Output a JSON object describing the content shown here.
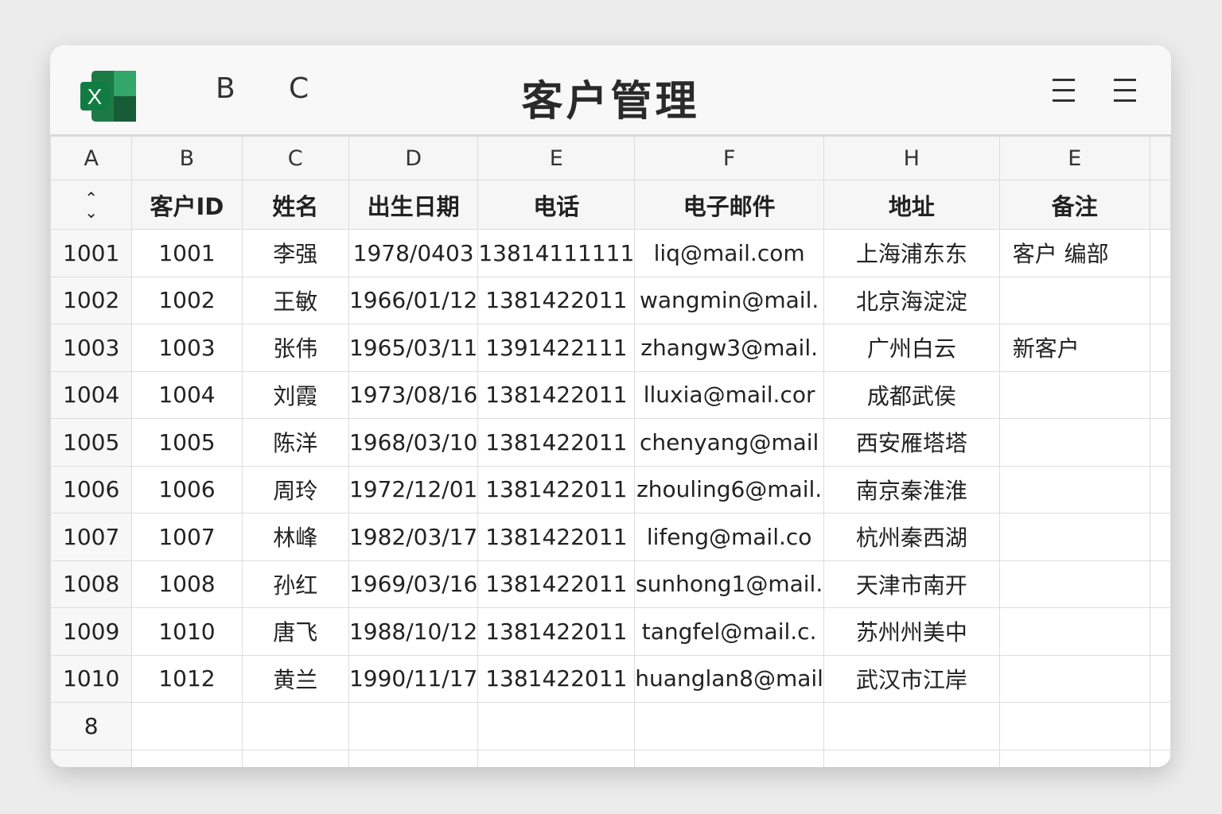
{
  "app": {
    "icon": "excel-icon",
    "icon_letter": "X",
    "tab_b": "B",
    "tab_c": "C",
    "title": "客户管理",
    "menu_icon_1": "menu-icon",
    "menu_icon_2": "menu-icon"
  },
  "column_letters": [
    "A",
    "B",
    "C",
    "D",
    "E",
    "F",
    "H",
    "E"
  ],
  "headers": [
    "客户ID",
    "姓名",
    "出生日期",
    "电话",
    "电子邮件",
    "地址",
    "备注"
  ],
  "sort_icon": "sort-icon",
  "rows": [
    {
      "row": "1001",
      "id": "1001",
      "name": "李强",
      "dob": "1978/0403",
      "phone": "13814111111",
      "email": "liq@mail.com",
      "addr": "上海浦东东",
      "note": "客户   编部"
    },
    {
      "row": "1002",
      "id": "1002",
      "name": "王敏",
      "dob": "1966/01/12",
      "phone": "1381422011",
      "email": "wangmin@mail.",
      "addr": "北京海淀淀",
      "note": ""
    },
    {
      "row": "1003",
      "id": "1003",
      "name": "张伟",
      "dob": "1965/03/11",
      "phone": "1391422111",
      "email": "zhangw3@mail.",
      "addr": "广州白云",
      "note": "新客户"
    },
    {
      "row": "1004",
      "id": "1004",
      "name": "刘霞",
      "dob": "1973/08/16",
      "phone": "1381422011",
      "email": "lluxia@mail.cor",
      "addr": "成都武侯",
      "note": ""
    },
    {
      "row": "1005",
      "id": "1005",
      "name": "陈洋",
      "dob": "1968/03/10",
      "phone": "1381422011",
      "email": "chenyang@mail",
      "addr": "西安雁塔塔",
      "note": ""
    },
    {
      "row": "1006",
      "id": "1006",
      "name": "周玲",
      "dob": "1972/12/01",
      "phone": "1381422011",
      "email": "zhouling6@mail.",
      "addr": "南京秦淮淮",
      "note": ""
    },
    {
      "row": "1007",
      "id": "1007",
      "name": "林峰",
      "dob": "1982/03/17",
      "phone": "1381422011",
      "email": "lifeng@mail.co",
      "addr": "杭州秦西湖",
      "note": ""
    },
    {
      "row": "1008",
      "id": "1008",
      "name": "孙红",
      "dob": "1969/03/16",
      "phone": "1381422011",
      "email": "sunhong1@mail.",
      "addr": "天津市南开",
      "note": ""
    },
    {
      "row": "1009",
      "id": "1010",
      "name": "唐飞",
      "dob": "1988/10/12",
      "phone": "1381422011",
      "email": "tangfel@mail.c.",
      "addr": "苏州州美中",
      "note": ""
    },
    {
      "row": "1010",
      "id": "1012",
      "name": "黄兰",
      "dob": "1990/11/17",
      "phone": "1381422011",
      "email": "huanglan8@mail",
      "addr": "武汉市江岸",
      "note": ""
    }
  ],
  "extra_row": "8"
}
